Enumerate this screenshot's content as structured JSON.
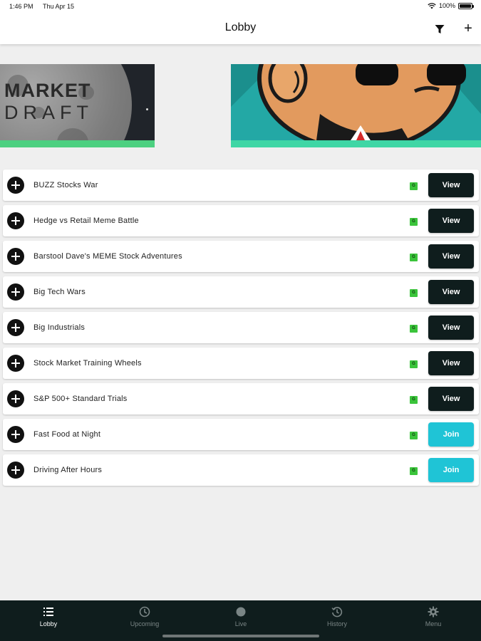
{
  "status_bar": {
    "time": "1:46 PM",
    "date": "Thu Apr 15",
    "battery": "100%",
    "battery_level": 1.0
  },
  "header": {
    "title": "Lobby"
  },
  "banners": [
    {
      "line1": "MARKET",
      "line2": "DRAFT"
    }
  ],
  "games": [
    {
      "name": "BUZZ Stocks War",
      "badge": "G",
      "action": "View"
    },
    {
      "name": "Hedge vs Retail Meme Battle",
      "badge": "G",
      "action": "View"
    },
    {
      "name": "Barstool Dave's MEME Stock Adventures",
      "badge": "G",
      "action": "View"
    },
    {
      "name": "Big Tech Wars",
      "badge": "G",
      "action": "View"
    },
    {
      "name": "Big Industrials",
      "badge": "G",
      "action": "View"
    },
    {
      "name": "Stock Market Training Wheels",
      "badge": "G",
      "action": "View"
    },
    {
      "name": "S&P 500+ Standard Trials",
      "badge": "G",
      "action": "View"
    },
    {
      "name": "Fast Food at Night",
      "badge": "G",
      "action": "Join"
    },
    {
      "name": "Driving After Hours",
      "badge": "G",
      "action": "Join"
    }
  ],
  "nav": {
    "items": [
      {
        "label": "Lobby",
        "icon": "list-icon",
        "active": true
      },
      {
        "label": "Upcoming",
        "icon": "clock-icon",
        "active": false
      },
      {
        "label": "Live",
        "icon": "live-dot-icon",
        "active": false
      },
      {
        "label": "History",
        "icon": "history-icon",
        "active": false
      },
      {
        "label": "Menu",
        "icon": "gear-icon",
        "active": false
      }
    ]
  },
  "colors": {
    "nav_background": "#0f1d1d",
    "view_button": "#0f1d1d",
    "join_button": "#1fc4d6",
    "badge": "#3bc43b",
    "banner_left_stripe": "#4cd080",
    "banner_right_stripe": "#3fd6a5"
  }
}
